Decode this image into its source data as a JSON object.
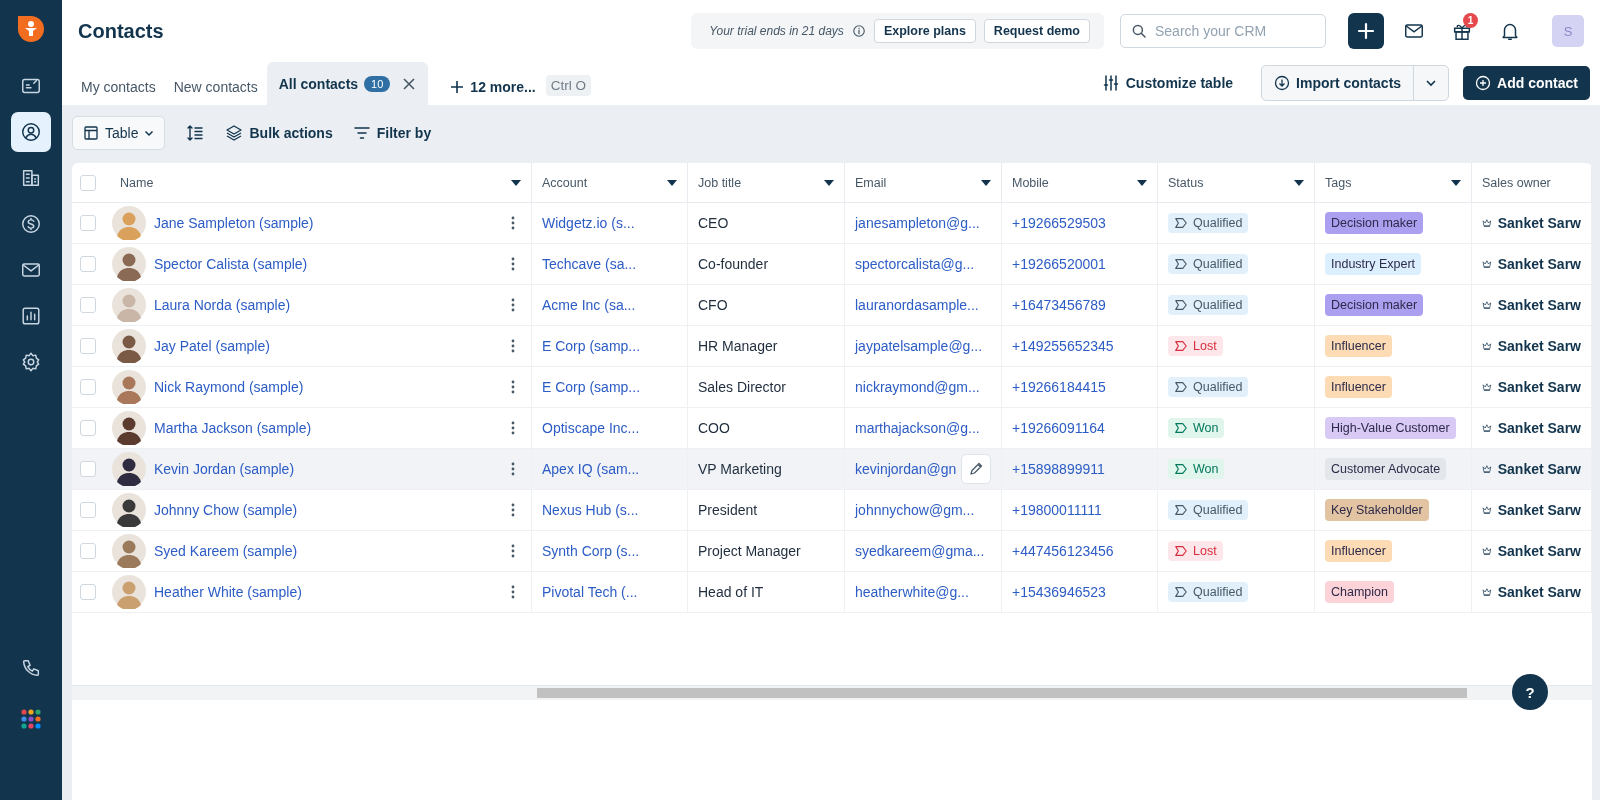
{
  "sidebar": {
    "items": [
      {
        "kind": "dashboard",
        "selected": false
      },
      {
        "kind": "contacts",
        "selected": true
      },
      {
        "kind": "accounts",
        "selected": false
      },
      {
        "kind": "deals",
        "selected": false
      },
      {
        "kind": "mail",
        "selected": false
      },
      {
        "kind": "reports",
        "selected": false
      },
      {
        "kind": "settings",
        "selected": false
      }
    ],
    "bottom_items": [
      {
        "kind": "phone",
        "selected": false
      },
      {
        "kind": "apps",
        "selected": false
      }
    ]
  },
  "header": {
    "title": "Contacts",
    "trial": {
      "text": "Your trial ends in 21 days",
      "buttons": [
        "Explore plans",
        "Request demo"
      ]
    },
    "search": {
      "placeholder": "Search your CRM"
    },
    "gift_badge": "1",
    "user_initial": "S"
  },
  "tabs": [
    {
      "label": "My contacts",
      "selected": false
    },
    {
      "label": "New contacts",
      "selected": false
    },
    {
      "label": "All contacts",
      "selected": true,
      "count": "10"
    }
  ],
  "more_tabs": "12 more...",
  "shortcut": "Ctrl O",
  "actions": {
    "customize": "Customize table",
    "import": "Import contacts",
    "add": "Add contact"
  },
  "toolbar": {
    "view": "Table",
    "bulk": "Bulk actions",
    "filter": "Filter by"
  },
  "table": {
    "select_all_checked": false,
    "columns": [
      {
        "label": "Name",
        "sortable": true
      },
      {
        "label": "Account",
        "sortable": true
      },
      {
        "label": "Job title",
        "sortable": true
      },
      {
        "label": "Email",
        "sortable": true
      },
      {
        "label": "Mobile",
        "sortable": true
      },
      {
        "label": "Status",
        "sortable": true
      },
      {
        "label": "Tags",
        "sortable": true
      },
      {
        "label": "Sales owner",
        "sortable": false
      }
    ],
    "rows": [
      {
        "checked": false,
        "highlighted": false,
        "name": "Jane Sampleton (sample)",
        "account": "Widgetz.io (s...",
        "job_title": "CEO",
        "email": "janesampleton@g...",
        "mobile": "+19266529503",
        "status": {
          "label": "Qualified",
          "kind": "qualified"
        },
        "tag": {
          "label": "Decision maker",
          "color": "#ab9ff0"
        },
        "sales_owner": "Sanket Sarw"
      },
      {
        "checked": false,
        "highlighted": false,
        "name": "Spector Calista (sample)",
        "account": "Techcave (sa...",
        "job_title": "Co-founder",
        "email": "spectorcalista@g...",
        "mobile": "+19266520001",
        "status": {
          "label": "Qualified",
          "kind": "qualified"
        },
        "tag": {
          "label": "Industry Expert",
          "color": "#dcefff"
        },
        "sales_owner": "Sanket Sarw"
      },
      {
        "checked": false,
        "highlighted": false,
        "name": "Laura Norda (sample)",
        "account": "Acme Inc (sa...",
        "job_title": "CFO",
        "email": "lauranordasample...",
        "mobile": "+16473456789",
        "status": {
          "label": "Qualified",
          "kind": "qualified"
        },
        "tag": {
          "label": "Decision maker",
          "color": "#ab9ff0"
        },
        "sales_owner": "Sanket Sarw"
      },
      {
        "checked": false,
        "highlighted": false,
        "name": "Jay Patel (sample)",
        "account": "E Corp (samp...",
        "job_title": "HR Manager",
        "email": "jaypatelsample@g...",
        "mobile": "+149255652345",
        "status": {
          "label": "Lost",
          "kind": "lost"
        },
        "tag": {
          "label": "Influencer",
          "color": "#fddcb5"
        },
        "sales_owner": "Sanket Sarw"
      },
      {
        "checked": false,
        "highlighted": false,
        "name": "Nick Raymond (sample)",
        "account": "E Corp (samp...",
        "job_title": "Sales Director",
        "email": "nickraymond@gm...",
        "mobile": "+19266184415",
        "status": {
          "label": "Qualified",
          "kind": "qualified"
        },
        "tag": {
          "label": "Influencer",
          "color": "#fddcb5"
        },
        "sales_owner": "Sanket Sarw"
      },
      {
        "checked": false,
        "highlighted": false,
        "name": "Martha Jackson (sample)",
        "account": "Optiscape Inc...",
        "job_title": "COO",
        "email": "marthajackson@g...",
        "mobile": "+19266091164",
        "status": {
          "label": "Won",
          "kind": "won"
        },
        "tag": {
          "label": "High-Value Customer",
          "color": "#d9c9f5"
        },
        "sales_owner": "Sanket Sarw"
      },
      {
        "checked": false,
        "highlighted": true,
        "name": "Kevin Jordan (sample)",
        "account": "Apex IQ (sam...",
        "job_title": "VP Marketing",
        "email": "kevinjordan@gn",
        "mobile": "+15898899911",
        "status": {
          "label": "Won",
          "kind": "won"
        },
        "tag": {
          "label": "Customer Advocate",
          "color": "#e3e6ea"
        },
        "sales_owner": "Sanket Sarw"
      },
      {
        "checked": false,
        "highlighted": false,
        "name": "Johnny Chow (sample)",
        "account": "Nexus Hub (s...",
        "job_title": "President",
        "email": "johnnychow@gm...",
        "mobile": "+19800011111",
        "status": {
          "label": "Qualified",
          "kind": "qualified"
        },
        "tag": {
          "label": "Key Stakeholder",
          "color": "#e2c4a2"
        },
        "sales_owner": "Sanket Sarw"
      },
      {
        "checked": false,
        "highlighted": false,
        "name": "Syed Kareem (sample)",
        "account": "Synth Corp (s...",
        "job_title": "Project Manager",
        "email": "syedkareem@gma...",
        "mobile": "+447456123456",
        "status": {
          "label": "Lost",
          "kind": "lost"
        },
        "tag": {
          "label": "Influencer",
          "color": "#fddcb5"
        },
        "sales_owner": "Sanket Sarw"
      },
      {
        "checked": false,
        "highlighted": false,
        "name": "Heather White (sample)",
        "account": "Pivotal Tech (...",
        "job_title": "Head of IT",
        "email": "heatherwhite@g...",
        "mobile": "+15436946523",
        "status": {
          "label": "Qualified",
          "kind": "qualified"
        },
        "tag": {
          "label": "Champion",
          "color": "#fcd3d8"
        },
        "sales_owner": "Sanket Sarw"
      }
    ]
  },
  "help_label": "?"
}
